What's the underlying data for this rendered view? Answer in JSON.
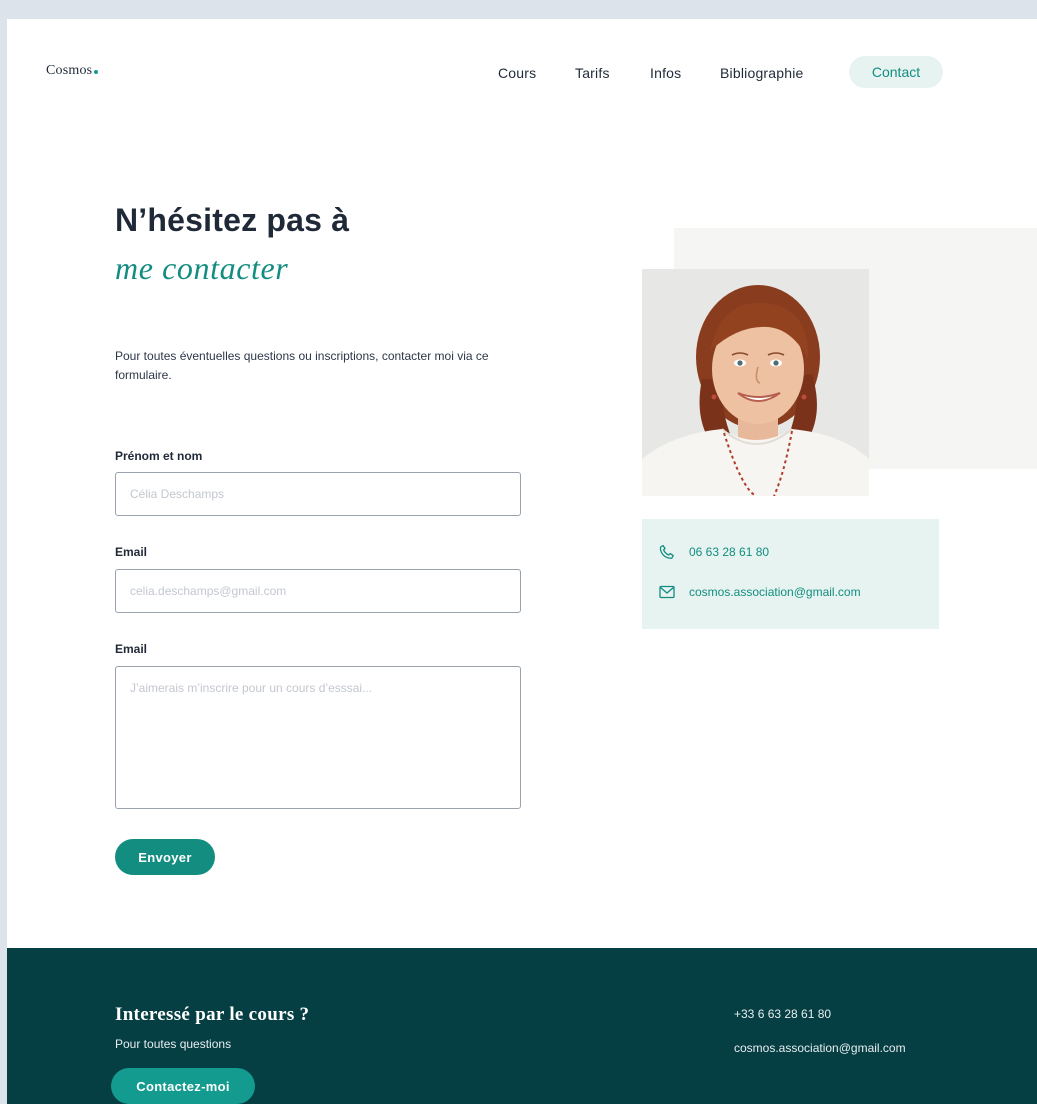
{
  "header": {
    "logo": "Cosmos",
    "nav": [
      {
        "label": "Cours"
      },
      {
        "label": "Tarifs"
      },
      {
        "label": "Infos"
      },
      {
        "label": "Bibliographie"
      },
      {
        "label": "Contact"
      }
    ]
  },
  "hero": {
    "title_line1": "N’hésitez pas à",
    "title_line2": "me contacter",
    "intro": "Pour toutes éventuelles questions ou inscriptions, contacter moi via ce formulaire."
  },
  "form": {
    "name_label": "Prénom et nom",
    "name_placeholder": "Célia Deschamps",
    "email_label": "Email",
    "email_placeholder": "celia.deschamps@gmail.com",
    "message_label": "Email",
    "message_placeholder": "J’aimerais m’inscrire pour un cours d’esssai...",
    "submit_label": "Envoyer"
  },
  "contact": {
    "phone": "06 63 28 61 80",
    "email": "cosmos.association@gmail.com"
  },
  "footer": {
    "title": "Interessé par le cours ?",
    "subtitle": "Pour toutes questions",
    "button_label": "Contactez-moi",
    "phone": "+33  6 63 28 61 80",
    "email": "cosmos.association@gmail.com"
  },
  "colors": {
    "accent": "#138d80",
    "accent_light": "#e6f3f0",
    "footer_bg": "#053e43"
  }
}
